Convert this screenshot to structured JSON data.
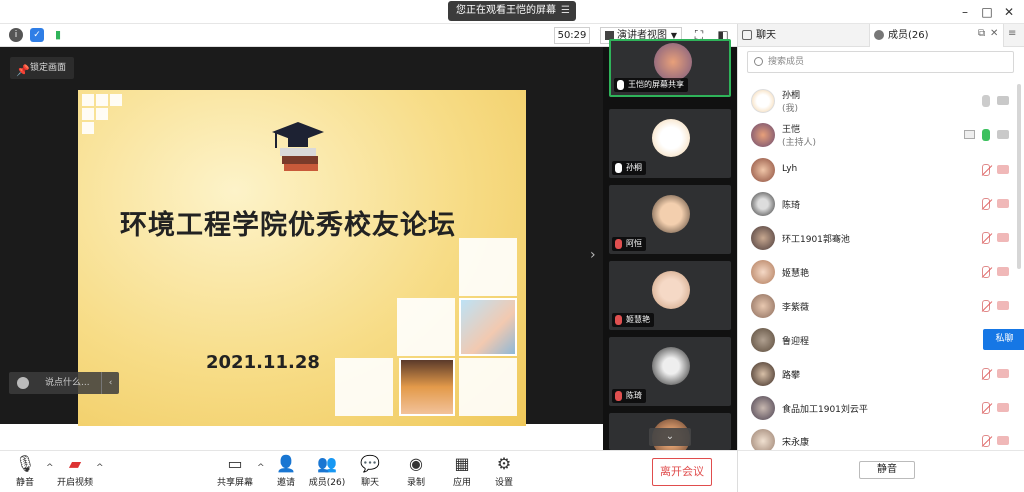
{
  "titlebar": {
    "sharing_text": "您正在观看王恺的屏幕",
    "minimize": "–",
    "maximize": "□",
    "close": "✕"
  },
  "toolbar2": {
    "timer": "50:29",
    "view_mode": "演讲者视图"
  },
  "share": {
    "lock_label": "锁定画面",
    "slide_title": "环境工程学院优秀校友论坛",
    "slide_date": "2021.11.28",
    "chat_placeholder": "说点什么..."
  },
  "strip": {
    "tiles": [
      {
        "name": "王恺的屏幕共享",
        "mic": "on"
      },
      {
        "name": "孙桐",
        "mic": "on"
      },
      {
        "name": "阿恒",
        "mic": "off"
      },
      {
        "name": "姬慧艳",
        "mic": "off"
      },
      {
        "name": "陈琦",
        "mic": "off"
      }
    ]
  },
  "bottombar": {
    "mute": "静音",
    "video": "开启视频",
    "share": "共享屏幕",
    "invite": "邀请",
    "members": "成员(26)",
    "chat": "聊天",
    "record": "录制",
    "apps": "应用",
    "settings": "设置",
    "leave": "离开会议"
  },
  "rpanel": {
    "tab_chat": "聊天",
    "tab_members": "成员(26)",
    "search_placeholder": "搜索成员",
    "private_chat": "私聊",
    "mute_all": "静音",
    "members": [
      {
        "name": "孙桐",
        "role": "(我)"
      },
      {
        "name": "王恺",
        "role": "(主持人)"
      },
      {
        "name": "Lyh"
      },
      {
        "name": "陈琦"
      },
      {
        "name": "环工1901郭骞池"
      },
      {
        "name": "姬慧艳"
      },
      {
        "name": "李紫薇"
      },
      {
        "name": "鲁迎程"
      },
      {
        "name": "路攀"
      },
      {
        "name": "食品加工1901刘云平"
      },
      {
        "name": "宋永康"
      }
    ]
  }
}
